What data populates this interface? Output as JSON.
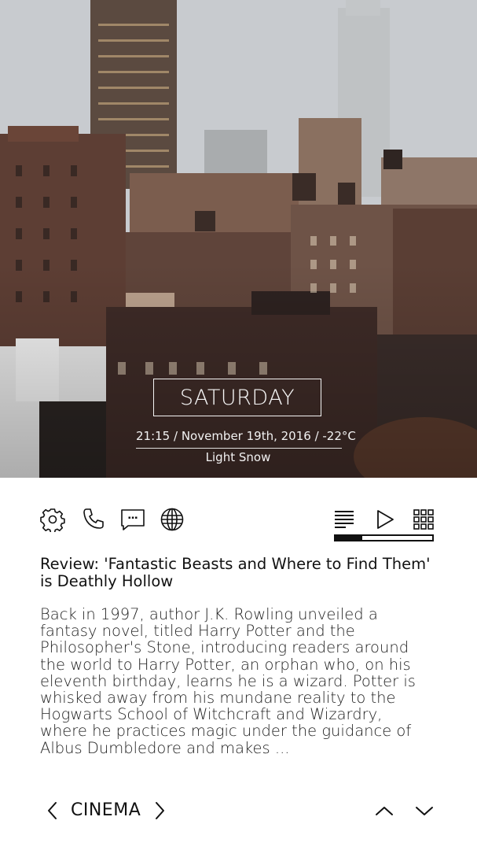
{
  "hero": {
    "day": "SATURDAY",
    "weather_line": "21:15 / November 19th, 2016 / -22°C",
    "condition": "Light Snow"
  },
  "toolbar": {
    "left_icons": [
      "gear-icon",
      "phone-icon",
      "message-icon",
      "globe-icon"
    ],
    "right_icons": [
      "list-icon",
      "play-icon",
      "grid-icon"
    ],
    "progress": 0.28
  },
  "article": {
    "title": "Review: 'Fantastic Beasts and Where to Find Them' is Deathly Hollow",
    "body": "Back in 1997, author J.K. Rowling unveiled a fantasy novel, titled Harry Potter and the Philosopher's Stone, introducing readers around the world to Harry Potter, an orphan who, on his eleventh birthday, learns he is a wizard. Potter is whisked away from his mundane reality to the Hogwarts School of Witchcraft and Wizardry, where he practices magic under the guidance of Albus Dumbledore and makes ..."
  },
  "bottom_nav": {
    "category": "CINEMA"
  }
}
